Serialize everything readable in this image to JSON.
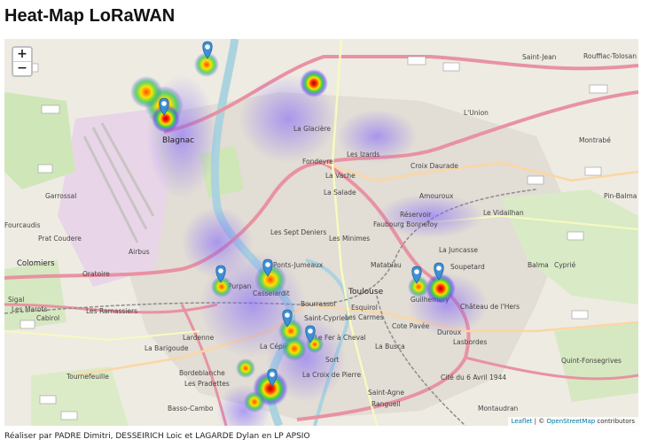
{
  "page": {
    "title": "Heat-Map LoRaWAN",
    "footer": "Réaliser par PADRE Dimitri, DESSEIRICH Loic et LAGARDE Dylan en LP APSIO"
  },
  "zoom": {
    "in_label": "+",
    "out_label": "−"
  },
  "attribution": {
    "leaflet": "Leaflet",
    "sep": " | © ",
    "osm": "OpenStreetMap",
    "suffix": " contributors"
  },
  "colors": {
    "heat_low": "#4a4ae0",
    "heat_mid": "#ffeb3b",
    "heat_high": "#e0001b",
    "marker": "#3f8fd8"
  },
  "map_labels": [
    "Saint-Jean",
    "Rouffiac-Tolosan",
    "L'Union",
    "Montrabé",
    "Blagnac",
    "La Glacière",
    "Les Izards",
    "Croix Daurade",
    "Fondeyre",
    "La Vache",
    "La Salade",
    "Garrossal",
    "Amouroux",
    "Le Vidailhan",
    "Réservoir",
    "Faubourg Bonnefoy",
    "Pin-Balma",
    "Fourcaudis",
    "Prat Coudere",
    "Les Minimes",
    "La Juncasse",
    "Colomiers",
    "Oratoire",
    "Les Sept Deniers",
    "Soupetard",
    "Balma",
    "Cyprié",
    "Matabiau",
    "Toulouse",
    "Guilheméry",
    "Saint-Cyprien",
    "Les Carmes",
    "Château de l'Hers",
    "Les Ramassiers",
    "Bourrassol",
    "Esquirol",
    "Cote Pavée",
    "Cabirol",
    "Les Marots",
    "Lardenne",
    "La Cépière",
    "Le Fer à Cheval",
    "La Busca",
    "Duroux",
    "La Barigoude",
    "Bordeblanche",
    "Les Pradettes",
    "Basso-Cambo",
    "Saint-Agne",
    "Cité du 6 Avril 1944",
    "Tournefeuille",
    "Quint-Fonsegrives",
    "Montaudran",
    "Rangueil",
    "La Croix de Pierre",
    "Purpan",
    "Casselardit",
    "Ponts-Jumeaux",
    "Airbus",
    "Sigal",
    "Lasbordes",
    "Sort"
  ],
  "markers": [
    "marker-aeroconstellation",
    "marker-blagnac",
    "marker-purpan",
    "marker-ponts-jumeaux",
    "marker-guilhemery-1",
    "marker-guilhemery-2",
    "marker-fer-a-cheval",
    "marker-cepiere",
    "marker-rangueil"
  ]
}
